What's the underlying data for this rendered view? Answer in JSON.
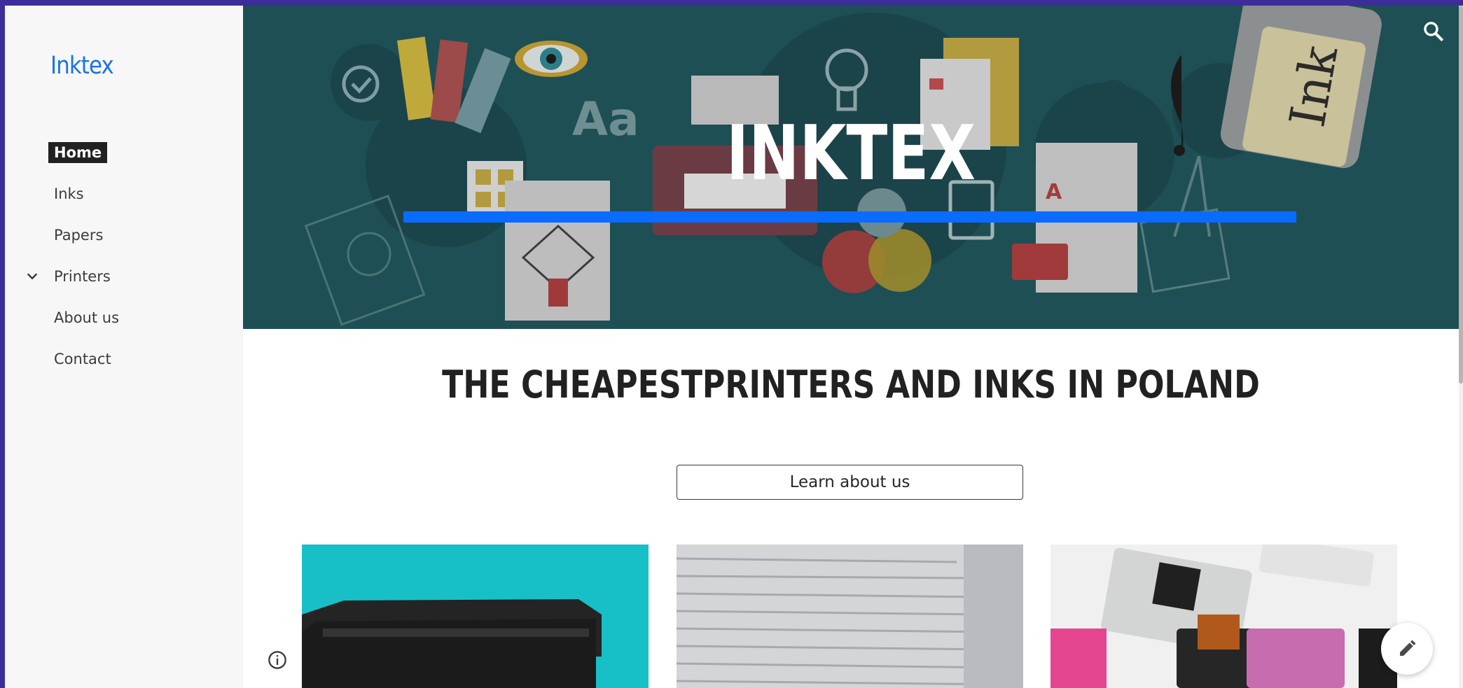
{
  "site": {
    "brand": "Inktex"
  },
  "nav": {
    "items": [
      {
        "label": "Home",
        "active": true
      },
      {
        "label": "Inks"
      },
      {
        "label": "Papers"
      },
      {
        "label": "Printers",
        "expandable": true
      },
      {
        "label": "About us"
      },
      {
        "label": "Contact"
      }
    ]
  },
  "hero": {
    "title": "INKTEX"
  },
  "main": {
    "headline": "THE CHEAPESTPRINTERS AND INKS IN POLAND",
    "cta_label": "Learn about us"
  },
  "colors": {
    "accent": "#0a6cff",
    "hero_bg": "#1e4f55",
    "brand": "#1a73e8",
    "frame": "#3b2d9a"
  },
  "icons": {
    "search": "search-icon",
    "info": "info-icon",
    "edit": "pencil-icon",
    "chevron": "chevron-down-icon"
  }
}
